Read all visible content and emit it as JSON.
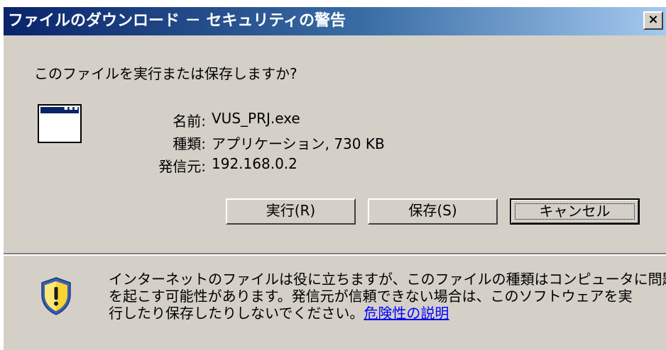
{
  "dialog": {
    "title": "ファイルのダウンロード － セキュリティの警告",
    "close_label": "×",
    "question": "このファイルを実行または保存しますか?",
    "file_info": {
      "name_label": "名前:",
      "name_value": "VUS_PRJ.exe",
      "type_label": "種類:",
      "type_value": "アプリケーション, 730 KB",
      "source_label": "発信元:",
      "source_value": "192.168.0.2"
    },
    "buttons": {
      "run": "実行(R)",
      "save": "保存(S)",
      "cancel": "キャンセル"
    },
    "warning": {
      "line1": "インターネットのファイルは役に立ちますが、このファイルの種類はコンピュータに問題",
      "line2": "を起こす可能性があります。発信元が信頼できない場合は、このソフトウェアを実",
      "line3": "行したり保存したりしないでください。",
      "link_text": "危険性の説明"
    },
    "colors": {
      "titlebar_start": "#0a246a",
      "titlebar_end": "#a6caf0",
      "face": "#d4d0c8",
      "shield_yellow": "#f6d433",
      "shield_blue": "#3a5fb0"
    }
  }
}
